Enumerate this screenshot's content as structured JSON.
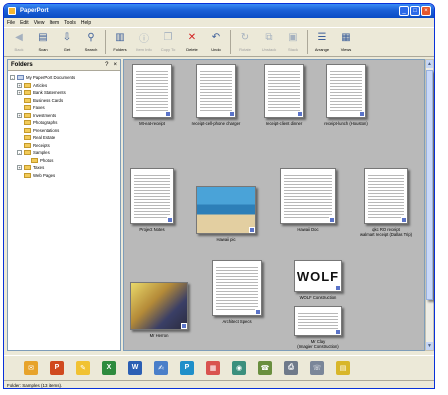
{
  "window": {
    "title": "PaperPort"
  },
  "menu": [
    "File",
    "Edit",
    "View",
    "Item",
    "Tools",
    "Help"
  ],
  "toolbar": [
    {
      "label": "Back",
      "icon": "back-icon",
      "enabled": false
    },
    {
      "label": "Scan",
      "icon": "scan-icon",
      "enabled": true
    },
    {
      "label": "Get",
      "icon": "get-icon",
      "enabled": true
    },
    {
      "label": "Search",
      "icon": "search-icon",
      "enabled": true
    },
    {
      "label": "Folders",
      "icon": "folders-icon",
      "enabled": true
    },
    {
      "label": "Item Info",
      "icon": "item-info-icon",
      "enabled": false
    },
    {
      "label": "Copy To",
      "icon": "copy-icon",
      "enabled": false
    },
    {
      "label": "Delete",
      "icon": "delete-icon",
      "enabled": true
    },
    {
      "label": "Undo",
      "icon": "undo-icon",
      "enabled": true
    },
    {
      "label": "Rotate",
      "icon": "rotate-icon",
      "enabled": false
    },
    {
      "label": "Unstack",
      "icon": "unstack-icon",
      "enabled": false
    },
    {
      "label": "Stack",
      "icon": "stack-icon",
      "enabled": false
    },
    {
      "label": "Arrange",
      "icon": "arrange-icon",
      "enabled": true
    },
    {
      "label": "Views",
      "icon": "views-icon",
      "enabled": true
    }
  ],
  "folders": {
    "title": "Folders",
    "help": "?",
    "close": "×",
    "tree": [
      {
        "label": "My PaperPort Documents",
        "level": 0,
        "expander": "-",
        "root": true
      },
      {
        "label": "Articles",
        "level": 1,
        "expander": "+"
      },
      {
        "label": "Bank Statements",
        "level": 1,
        "expander": "+"
      },
      {
        "label": "Business Cards",
        "level": 1,
        "expander": ""
      },
      {
        "label": "Faxes",
        "level": 1,
        "expander": ""
      },
      {
        "label": "Investments",
        "level": 1,
        "expander": "+"
      },
      {
        "label": "Photographs",
        "level": 1,
        "expander": ""
      },
      {
        "label": "Presentations",
        "level": 1,
        "expander": ""
      },
      {
        "label": "Real Estate",
        "level": 1,
        "expander": ""
      },
      {
        "label": "Receipts",
        "level": 1,
        "expander": ""
      },
      {
        "label": "Samples",
        "level": 1,
        "expander": "-"
      },
      {
        "label": "Photos",
        "level": 2,
        "expander": ""
      },
      {
        "label": "Taxes",
        "level": 1,
        "expander": "+"
      },
      {
        "label": "Web Pages",
        "level": 1,
        "expander": ""
      }
    ]
  },
  "items": [
    {
      "caption": "Mt-eat-receipt",
      "kind": "receipt"
    },
    {
      "caption": "receipt-cell-phone charger",
      "kind": "receipt"
    },
    {
      "caption": "receipt-client dinner",
      "kind": "receipt"
    },
    {
      "caption": "receipt-lunch (Houston)",
      "kind": "receipt"
    },
    {
      "caption": "Project Notes",
      "kind": "doc"
    },
    {
      "caption": "Hawaii pic",
      "kind": "beach"
    },
    {
      "caption": "Hawaii Doc",
      "kind": "doc"
    },
    {
      "caption": "qkc RO receipt\nwalmart receipt (Dallas Trip)",
      "kind": "receipt"
    },
    {
      "caption": "Architect Specs",
      "kind": "doc"
    },
    {
      "caption": "Mr Herron",
      "kind": "worker"
    },
    {
      "caption": "WOLF Construction",
      "kind": "wolf",
      "logo_text": "WOLF"
    },
    {
      "caption": "Mr Clay\n(Imagier Construction)",
      "kind": "card"
    }
  ],
  "appbar": [
    {
      "icon": "mail-app-icon",
      "color": "#e7a32b",
      "glyph": "✉"
    },
    {
      "icon": "powerpoint-app-icon",
      "color": "#d04a1e",
      "glyph": "P"
    },
    {
      "icon": "paint-app-icon",
      "color": "#f1c232",
      "glyph": "✎"
    },
    {
      "icon": "excel-app-icon",
      "color": "#2e8b3e",
      "glyph": "X"
    },
    {
      "icon": "word-app-icon",
      "color": "#2b5fb4",
      "glyph": "W"
    },
    {
      "icon": "notepad-app-icon",
      "color": "#4a7fc9",
      "glyph": "✍"
    },
    {
      "icon": "publisher-app-icon",
      "color": "#1f8fc9",
      "glyph": "P"
    },
    {
      "icon": "slides-app-icon",
      "color": "#d9534f",
      "glyph": "▦"
    },
    {
      "icon": "ocr-app-icon",
      "color": "#3b8f7d",
      "glyph": "◉"
    },
    {
      "icon": "fax-app-icon",
      "color": "#6a8f3f",
      "glyph": "☎"
    },
    {
      "icon": "printer-app-icon",
      "color": "#6f7a8a",
      "glyph": "⎙"
    },
    {
      "icon": "dialer-app-icon",
      "color": "#7a8699",
      "glyph": "☏"
    },
    {
      "icon": "notes-app-icon",
      "color": "#d8b62a",
      "glyph": "▤"
    }
  ],
  "status": {
    "text": "Folder: Samples (13 items)."
  }
}
